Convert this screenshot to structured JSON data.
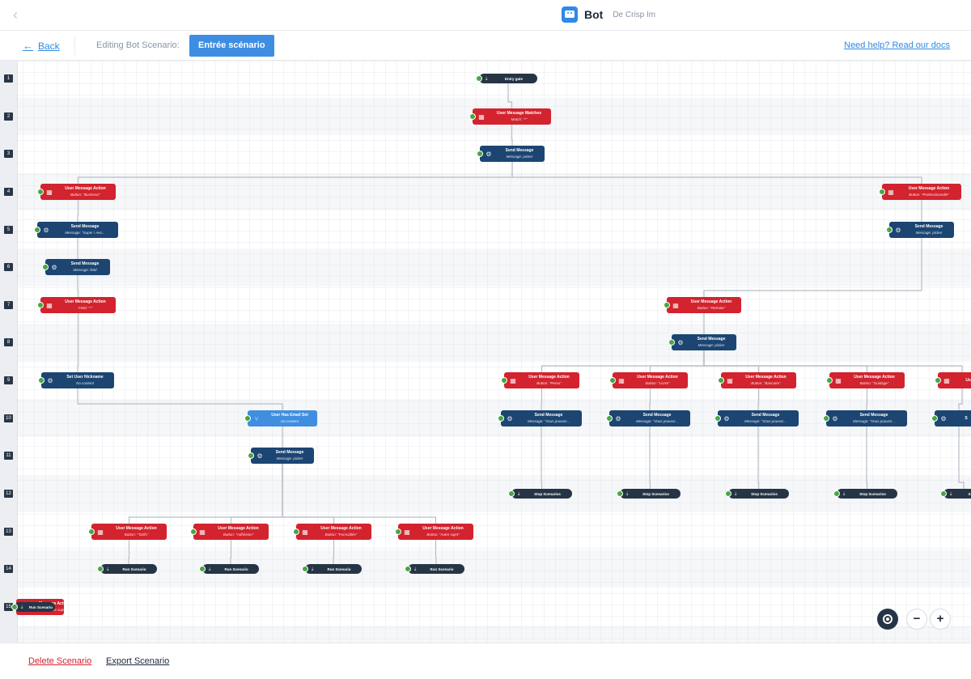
{
  "app": {
    "title": "Bot",
    "subtitle": "De Crisp Im"
  },
  "toolbar": {
    "back_label": "Back",
    "editing_label": "Editing Bot Scenario:",
    "scenario_name": "Entrée scénario",
    "help_link": "Need help? Read our docs"
  },
  "row_numbers": [
    "1",
    "2",
    "3",
    "4",
    "5",
    "6",
    "7",
    "8",
    "9",
    "10",
    "11",
    "12",
    "13",
    "14",
    "15"
  ],
  "nodes": [
    {
      "kind": "pill",
      "title": "Entry gate",
      "subtitle": "",
      "icon": "start-icon"
    },
    {
      "kind": "red",
      "title": "User Message Matches",
      "subtitle": "Match: \"*\"",
      "icon": "calendar-icon"
    },
    {
      "kind": "navy",
      "title": "Send Message",
      "subtitle": "Message: picker",
      "icon": "gears-icon"
    },
    {
      "kind": "red",
      "title": "User Message Action",
      "subtitle": "Button: \"Business\"",
      "icon": "calendar-icon"
    },
    {
      "kind": "red",
      "title": "User Message Action",
      "subtitle": "Button: \"Professionnelle\"",
      "icon": "calendar-icon"
    },
    {
      "kind": "navy",
      "title": "Send Message",
      "subtitle": "Message: \"Super ! Avo...",
      "icon": "gears-icon"
    },
    {
      "kind": "navy",
      "title": "Send Message",
      "subtitle": "Message: picker",
      "icon": "gears-icon"
    },
    {
      "kind": "navy",
      "title": "Send Message",
      "subtitle": "Message: field",
      "icon": "gears-icon"
    },
    {
      "kind": "red",
      "title": "User Message Action",
      "subtitle": "Button: \"Retraite\"",
      "icon": "calendar-icon"
    },
    {
      "kind": "red",
      "title": "User Message Action",
      "subtitle": "Field: \"*\"",
      "icon": "calendar-icon"
    },
    {
      "kind": "navy",
      "title": "Send Message",
      "subtitle": "Message: picker",
      "icon": "gears-icon"
    },
    {
      "kind": "navy",
      "title": "Set User Nickname",
      "subtitle": "No content",
      "icon": "gears-icon"
    },
    {
      "kind": "red",
      "title": "User Message Action",
      "subtitle": "Button: \"Perso\"",
      "icon": "calendar-icon"
    },
    {
      "kind": "red",
      "title": "User Message Action",
      "subtitle": "Button: \"Livret\"",
      "icon": "calendar-icon"
    },
    {
      "kind": "red",
      "title": "User Message Action",
      "subtitle": "Button: \"Bancaire\"",
      "icon": "calendar-icon"
    },
    {
      "kind": "red",
      "title": "User Message Action",
      "subtitle": "Button: \"Guidage\"",
      "icon": "calendar-icon"
    },
    {
      "kind": "red",
      "title": "Use",
      "subtitle": "",
      "icon": "calendar-icon"
    },
    {
      "kind": "blue",
      "title": "User Has Email Set",
      "subtitle": "No content",
      "icon": "branch-icon"
    },
    {
      "kind": "navy",
      "title": "Send Message",
      "subtitle": "Message: \"Vous pouvez...",
      "icon": "gears-icon"
    },
    {
      "kind": "navy",
      "title": "Send Message",
      "subtitle": "Message: \"Vous pouvez...",
      "icon": "gears-icon"
    },
    {
      "kind": "navy",
      "title": "Send Message",
      "subtitle": "Message: \"Vous pouvez...",
      "icon": "gears-icon"
    },
    {
      "kind": "navy",
      "title": "Send Message",
      "subtitle": "Message: \"Vous pouvez...",
      "icon": "gears-icon"
    },
    {
      "kind": "navy",
      "title": "S",
      "subtitle": "",
      "icon": "gears-icon"
    },
    {
      "kind": "navy",
      "title": "Send Message",
      "subtitle": "Message: picker",
      "icon": "gears-icon"
    },
    {
      "kind": "pill",
      "title": "Stop Scenarios",
      "subtitle": "",
      "icon": "stop-icon"
    },
    {
      "kind": "pill",
      "title": "Stop Scenarios",
      "subtitle": "",
      "icon": "stop-icon"
    },
    {
      "kind": "pill",
      "title": "Stop Scenarios",
      "subtitle": "",
      "icon": "stop-icon"
    },
    {
      "kind": "pill",
      "title": "Stop Scenarios",
      "subtitle": "",
      "icon": "stop-icon"
    },
    {
      "kind": "pill",
      "title": "S",
      "subtitle": "",
      "icon": "stop-icon"
    },
    {
      "kind": "red",
      "title": "User Message Action",
      "subtitle": "Button: \"Tarifs\"",
      "icon": "calendar-icon"
    },
    {
      "kind": "red",
      "title": "User Message Action",
      "subtitle": "Button: \"Adhésion\"",
      "icon": "calendar-icon"
    },
    {
      "kind": "red",
      "title": "User Message Action",
      "subtitle": "Button: \"Formalités\"",
      "icon": "calendar-icon"
    },
    {
      "kind": "red",
      "title": "User Message Action",
      "subtitle": "Button: \"Autre sujet\"",
      "icon": "calendar-icon"
    },
    {
      "kind": "pill",
      "title": "Run Scenario",
      "subtitle": "",
      "icon": "run-icon"
    },
    {
      "kind": "pill",
      "title": "Run Scenario",
      "subtitle": "",
      "icon": "run-icon"
    },
    {
      "kind": "pill",
      "title": "Run Scenario",
      "subtitle": "",
      "icon": "run-icon"
    },
    {
      "kind": "pill",
      "title": "Run Scenario",
      "subtitle": "",
      "icon": "run-icon"
    },
    {
      "kind": "red",
      "title": "er Message Action",
      "subtitle": "Button: \"Autre sujet\"",
      "icon": "calendar-icon"
    },
    {
      "kind": "pill",
      "title": "Run Scenario",
      "subtitle": "",
      "icon": "run-icon"
    }
  ],
  "zoom": {
    "recenter_icon": "target-icon",
    "zoom_out_label": "−",
    "zoom_in_label": "+"
  },
  "footer": {
    "delete_label": "Delete Scenario",
    "export_label": "Export Scenario"
  },
  "colors": {
    "accent": "#3d8ee3",
    "condition": "#d2232e",
    "action": "#1c4572",
    "terminal": "#263546",
    "ok": "#47a644"
  }
}
